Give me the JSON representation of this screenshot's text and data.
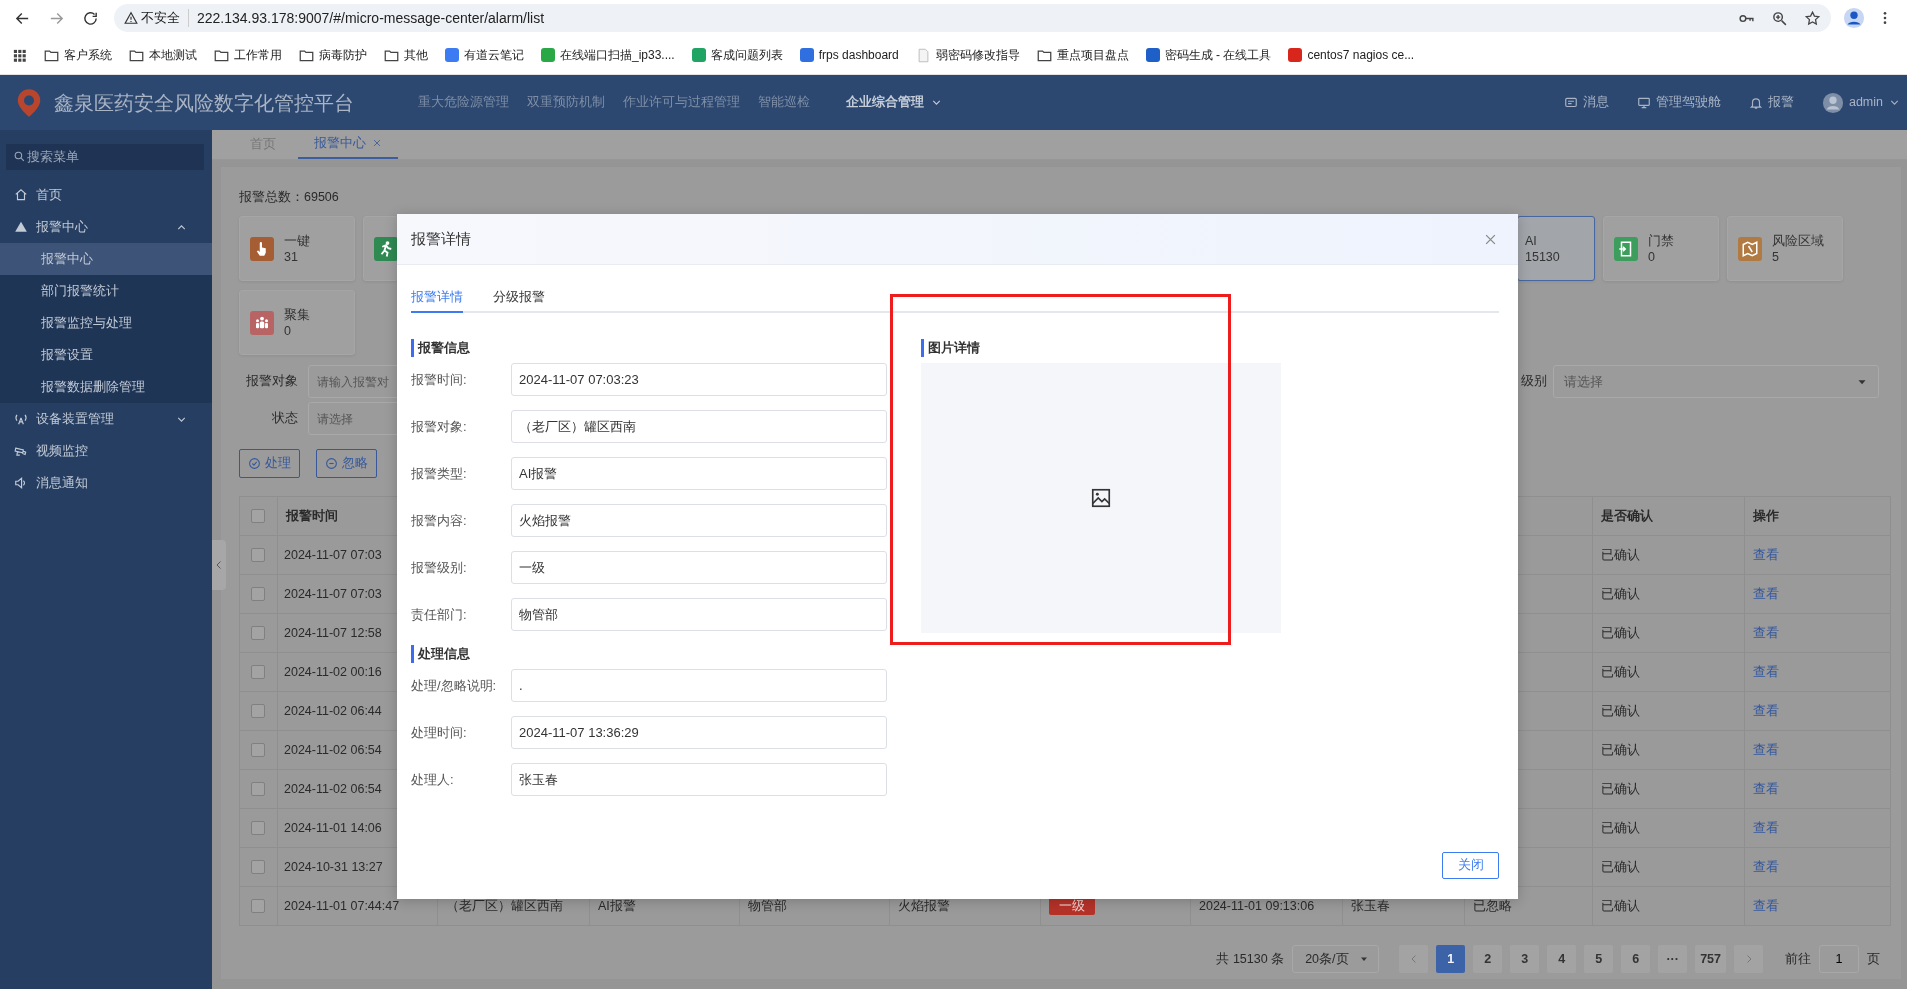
{
  "browser": {
    "security_label": "不安全",
    "url": "222.134.93.178:9007/#/micro-message-center/alarm/list",
    "bookmarks": [
      {
        "kind": "folder",
        "label": "客户系统"
      },
      {
        "kind": "folder",
        "label": "本地测试"
      },
      {
        "kind": "folder",
        "label": "工作常用"
      },
      {
        "kind": "folder",
        "label": "病毒防护"
      },
      {
        "kind": "folder",
        "label": "其他"
      },
      {
        "kind": "site",
        "label": "有道云笔记",
        "color": "#3d7bf2"
      },
      {
        "kind": "site",
        "label": "在线端口扫描_ip33....",
        "color": "#2aa845"
      },
      {
        "kind": "site",
        "label": "客成问题列表",
        "color": "#1fa463"
      },
      {
        "kind": "site",
        "label": "frps dashboard",
        "color": "#2f6fe0"
      },
      {
        "kind": "page",
        "label": "弱密码修改指导"
      },
      {
        "kind": "folder",
        "label": "重点项目盘点"
      },
      {
        "kind": "site",
        "label": "密码生成 - 在线工具",
        "color": "#1f5fc8"
      },
      {
        "kind": "site",
        "label": "centos7 nagios ce...",
        "color": "#d9261c"
      }
    ]
  },
  "app": {
    "title": "鑫泉医药安全风险数字化管控平台",
    "nav": [
      {
        "label": "重大危险源管理",
        "selected": false
      },
      {
        "label": "双重预防机制",
        "selected": false
      },
      {
        "label": "作业许可与过程管理",
        "selected": false
      },
      {
        "label": "智能巡检",
        "selected": false
      },
      {
        "label": "企业综合管理",
        "selected": true
      }
    ],
    "tools": [
      {
        "label": "消息"
      },
      {
        "label": "管理驾驶舱"
      },
      {
        "label": "报警"
      }
    ],
    "user": "admin"
  },
  "sidebar": {
    "search_placeholder": "搜索菜单",
    "items": [
      {
        "kind": "link",
        "label": "首页"
      },
      {
        "kind": "group",
        "label": "报警中心",
        "expanded": true,
        "children": [
          {
            "label": "报警中心",
            "selected": true
          },
          {
            "label": "部门报警统计",
            "selected": false
          },
          {
            "label": "报警监控与处理",
            "selected": false
          },
          {
            "label": "报警设置",
            "selected": false
          },
          {
            "label": "报警数据删除管理",
            "selected": false
          }
        ]
      },
      {
        "kind": "group",
        "label": "设备装置管理",
        "expanded": false
      },
      {
        "kind": "link",
        "label": "视频监控"
      },
      {
        "kind": "link",
        "label": "消息通知"
      }
    ]
  },
  "tabs": [
    {
      "label": "首页",
      "selected": false,
      "closable": false
    },
    {
      "label": "报警中心",
      "selected": true,
      "closable": true
    }
  ],
  "summary": "报警总数：69506",
  "stat_rows": [
    {
      "left": [
        {
          "color": "#a55d33",
          "label": "一键",
          "count": "31",
          "selected": false
        },
        {
          "color": "#2f8a52",
          "selected": false
        }
      ],
      "right": [
        {
          "label": "AI",
          "count": "15130",
          "selected": true
        },
        {
          "color": "#3c9d5c",
          "label": "门禁",
          "count": "0",
          "selected": false
        },
        {
          "color": "#b07a42",
          "label": "风险区域",
          "count": "5",
          "selected": false
        }
      ]
    },
    {
      "left": [
        {
          "color": "#b96464",
          "label": "聚集",
          "count": "0",
          "selected": false
        }
      ]
    }
  ],
  "filters": [
    {
      "left": {
        "label": "报警对象",
        "placeholder": "请输入报警对",
        "caret": false
      },
      "right": {
        "label": "级别",
        "placeholder": "请选择",
        "caret": true
      }
    },
    {
      "left": {
        "label": "状态",
        "placeholder": "请选择",
        "caret": false
      }
    }
  ],
  "actions": [
    {
      "label": "处理"
    },
    {
      "label": "忽略"
    }
  ],
  "table": {
    "header_checked": false,
    "columns": {
      "alarm_time": "报警时间",
      "confirmation": "是否确认",
      "action": "操作"
    },
    "rows": [
      {
        "checked": false,
        "alarm_time": "2024-11-07 07:03",
        "confirmation": "已确认",
        "action": "查看"
      },
      {
        "checked": false,
        "alarm_time": "2024-11-07 07:03",
        "confirmation": "已确认",
        "action": "查看"
      },
      {
        "checked": false,
        "alarm_time": "2024-11-07 12:58",
        "confirmation": "已确认",
        "action": "查看"
      },
      {
        "checked": false,
        "alarm_time": "2024-11-02 00:16",
        "confirmation": "已确认",
        "action": "查看"
      },
      {
        "checked": false,
        "alarm_time": "2024-11-02 06:44",
        "confirmation": "已确认",
        "action": "查看"
      },
      {
        "checked": false,
        "alarm_time": "2024-11-02 06:54",
        "confirmation": "已确认",
        "action": "查看"
      },
      {
        "checked": false,
        "alarm_time": "2024-11-02 06:54",
        "confirmation": "已确认",
        "action": "查看"
      },
      {
        "checked": false,
        "alarm_time": "2024-11-01 14:06",
        "confirmation": "已确认",
        "action": "查看"
      },
      {
        "checked": false,
        "alarm_time": "2024-10-31 13:27",
        "confirmation": "已确认",
        "action": "查看"
      },
      {
        "checked": false,
        "alarm_time": "2024-11-01 07:44:47",
        "column_3": "（老厂区）罐区西南",
        "column_4": "AI报警",
        "column_5": "物管部",
        "column_6": "火焰报警",
        "column_7": "一级",
        "column_8": "2024-11-01 09:13:06",
        "column_9": "张玉春",
        "column_10": "已忽略",
        "confirmation": "已确认",
        "action": "查看"
      }
    ]
  },
  "pagination": {
    "total": "共 15130 条",
    "page_size": "20条/页",
    "pages": [
      {
        "label": "1",
        "selected": true
      },
      {
        "label": "2",
        "selected": false
      },
      {
        "label": "3",
        "selected": false
      },
      {
        "label": "4",
        "selected": false
      },
      {
        "label": "5",
        "selected": false
      },
      {
        "label": "6",
        "selected": false
      },
      {
        "label": "···",
        "selected": false
      },
      {
        "label": "757",
        "selected": false
      }
    ],
    "goto_label": "前往",
    "goto_value": "1",
    "page_suffix": "页"
  },
  "modal": {
    "title": "报警详情",
    "highlight": true,
    "tabs": [
      {
        "label": "报警详情",
        "selected": true
      },
      {
        "label": "分级报警",
        "selected": false
      }
    ],
    "sections": [
      {
        "title": "报警信息",
        "fields": [
          {
            "label": "报警时间:",
            "value": "2024-11-07 07:03:23"
          },
          {
            "label": "报警对象:",
            "value": "（老厂区）罐区西南"
          },
          {
            "label": "报警类型:",
            "value": "AI报警"
          },
          {
            "label": "报警内容:",
            "value": "火焰报警"
          },
          {
            "label": "报警级别:",
            "value": "一级"
          },
          {
            "label": "责任部门:",
            "value": "物管部"
          }
        ]
      },
      {
        "title": "处理信息",
        "fields": [
          {
            "label": "处理/忽略说明:",
            "value": "."
          },
          {
            "label": "处理时间:",
            "value": "2024-11-07 13:36:29"
          },
          {
            "label": "处理人:",
            "value": "张玉春"
          }
        ]
      }
    ],
    "image_title": "图片详情",
    "close_button": "关闭"
  }
}
